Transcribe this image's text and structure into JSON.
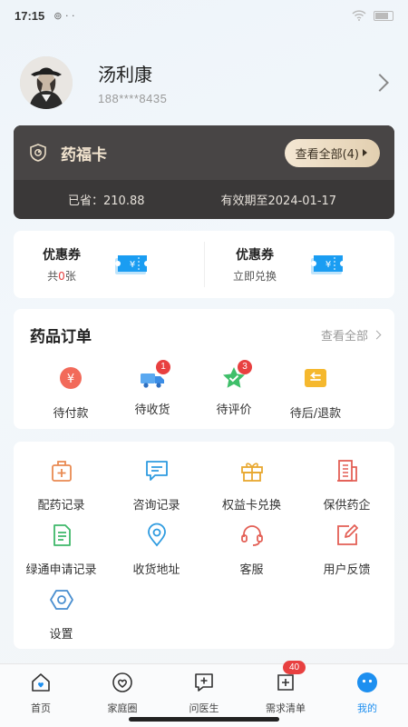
{
  "status_bar": {
    "time": "17:15",
    "left_icons": "⊚ · ·"
  },
  "profile": {
    "name": "汤利康",
    "phone": "188****8435",
    "avatar": "avatar-portrait-icon"
  },
  "card": {
    "title": "药福卡",
    "view_all": "查看全部(4)",
    "saved": "已省：210.88",
    "valid_until": "有效期至2024-01-17"
  },
  "coupons": [
    {
      "title": "优惠券",
      "sub_prefix": "共",
      "sub_count": "0",
      "sub_suffix": "张"
    },
    {
      "title": "优惠券",
      "sub": "立即兑换"
    }
  ],
  "orders": {
    "title": "药品订单",
    "view_all": "查看全部",
    "items": [
      {
        "label": "待付款",
        "icon": "yen-icon",
        "badge": ""
      },
      {
        "label": "待收货",
        "icon": "truck-icon",
        "badge": "1"
      },
      {
        "label": "待评价",
        "icon": "star-check-icon",
        "badge": "3"
      },
      {
        "label": "待后/退款",
        "icon": "refund-icon",
        "badge": ""
      }
    ]
  },
  "services": [
    {
      "label": "配药记录",
      "icon": "medkit-icon"
    },
    {
      "label": "咨询记录",
      "icon": "chat-icon"
    },
    {
      "label": "权益卡兑换",
      "icon": "gift-icon"
    },
    {
      "label": "保供药企",
      "icon": "building-icon"
    },
    {
      "label": "绿通申请记录",
      "icon": "document-icon"
    },
    {
      "label": "收货地址",
      "icon": "location-icon"
    },
    {
      "label": "客服",
      "icon": "headset-icon"
    },
    {
      "label": "用户反馈",
      "icon": "edit-icon"
    },
    {
      "label": "设置",
      "icon": "settings-icon"
    }
  ],
  "tabbar": {
    "items": [
      {
        "label": "首页",
        "icon": "home-heart-icon"
      },
      {
        "label": "家庭圈",
        "icon": "heart-circle-icon"
      },
      {
        "label": "问医生",
        "icon": "chat-plus-icon"
      },
      {
        "label": "需求清单",
        "icon": "list-plus-icon"
      },
      {
        "label": "我的",
        "icon": "profile-face-icon"
      }
    ],
    "badge": "40",
    "active": "我的"
  },
  "colors": {
    "accent": "#1d8ff0",
    "badge": "#e84040",
    "card_bg": "#3a3838",
    "gold": "#e2cfb0"
  }
}
